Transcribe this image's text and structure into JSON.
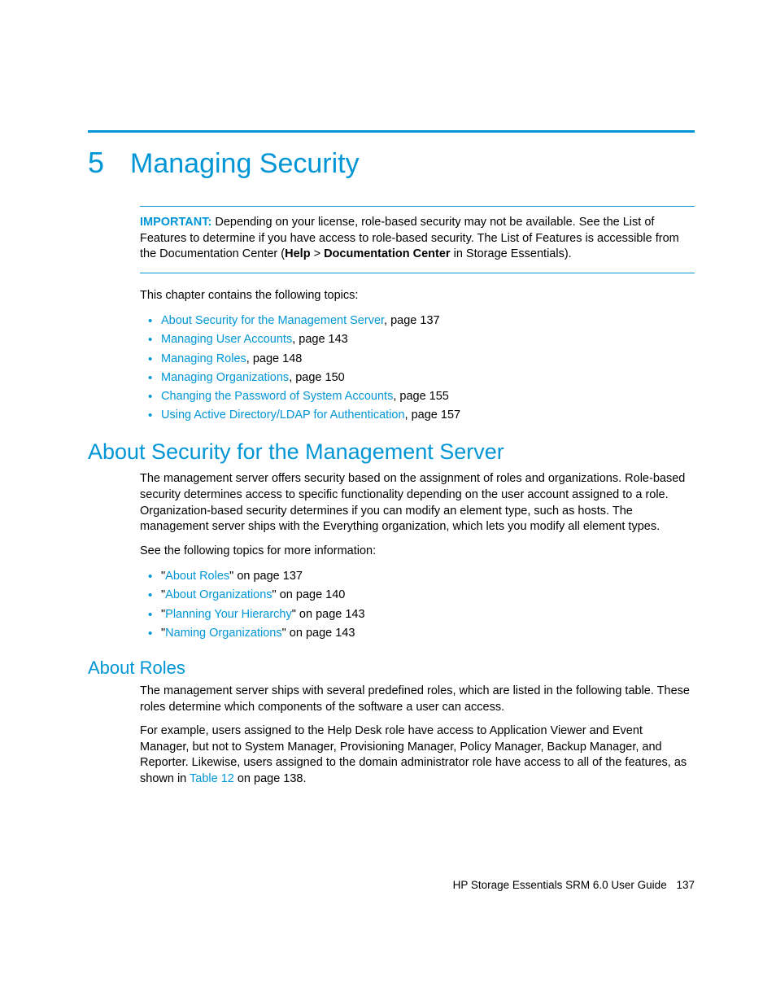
{
  "chapter": {
    "number": "5",
    "title": "Managing Security"
  },
  "important": {
    "label": "IMPORTANT:",
    "text_a": "Depending on your license, role-based security may not be available. See the List of Features to determine if you have access to role-based security. The List of Features is accessible from the Documentation Center (",
    "help": "Help",
    "sep": " > ",
    "doc_center": "Documentation Center",
    "text_b": " in Storage Essentials)."
  },
  "intro": "This chapter contains the following topics:",
  "topics": [
    {
      "link": "About Security for the Management Server",
      "suffix": ", page 137"
    },
    {
      "link": "Managing User Accounts",
      "suffix": ", page 143"
    },
    {
      "link": "Managing Roles",
      "suffix": ", page 148"
    },
    {
      "link": "Managing Organizations",
      "suffix": ", page 150"
    },
    {
      "link": "Changing the Password of System Accounts",
      "suffix": ", page 155"
    },
    {
      "link": "Using Active Directory/LDAP for Authentication",
      "suffix": ", page 157"
    }
  ],
  "section1": {
    "heading": "About Security for the Management Server",
    "para1": "The management server offers security based on the assignment of roles and organizations. Role-based security determines access to specific functionality depending on the user account assigned to a role. Organization-based security determines if you can modify an element type, such as hosts. The management server ships with the Everything organization, which lets you modify all element types.",
    "para2": "See the following topics for more information:",
    "subtopics": [
      {
        "q1": "\"",
        "link": "About Roles",
        "q2": "\" on page 137"
      },
      {
        "q1": "\"",
        "link": "About Organizations",
        "q2": "\" on page 140"
      },
      {
        "q1": "\"",
        "link": "Planning Your Hierarchy",
        "q2": "\" on page 143"
      },
      {
        "q1": "\"",
        "link": "Naming Organizations",
        "q2": "\" on page 143"
      }
    ]
  },
  "section2": {
    "heading": "About Roles",
    "para1": "The management server ships with several predefined roles, which are listed in the following table. These roles determine which components of the software a user can access.",
    "para2a": "For example, users assigned to the Help Desk role have access to Application Viewer and Event Manager, but not to System Manager, Provisioning Manager, Policy Manager, Backup Manager, and Reporter. Likewise, users assigned to the domain administrator role have access to all of the features, as shown in ",
    "para2link": "Table 12",
    "para2b": " on page 138."
  },
  "footer": {
    "text": "HP Storage Essentials SRM 6.0 User Guide",
    "page": "137"
  }
}
